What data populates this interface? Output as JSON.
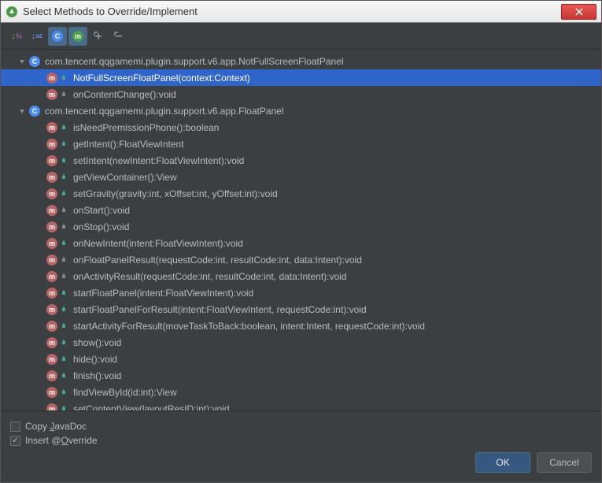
{
  "window": {
    "title": "Select Methods to Override/Implement"
  },
  "toolbar": {
    "sort_visibility": "↓%",
    "sort_alpha": "↓az",
    "filter_class": "C",
    "filter_method": "m",
    "expand": "⇱",
    "collapse": "⇲"
  },
  "tree": {
    "classes": [
      {
        "name": "com.tencent.qqgamemi.plugin.support.v6.app.NotFullScreenFloatPanel",
        "methods": [
          {
            "signature": "NotFullScreenFloatPanel(context:Context)",
            "visibility": "public",
            "selected": true
          },
          {
            "signature": "onContentChange():void",
            "visibility": "package"
          }
        ]
      },
      {
        "name": "com.tencent.qqgamemi.plugin.support.v6.app.FloatPanel",
        "methods": [
          {
            "signature": "isNeedPremissionPhone():boolean",
            "visibility": "public"
          },
          {
            "signature": "getIntent():FloatViewIntent",
            "visibility": "public"
          },
          {
            "signature": "setIntent(newIntent:FloatViewIntent):void",
            "visibility": "public"
          },
          {
            "signature": "getViewContainer():View",
            "visibility": "public"
          },
          {
            "signature": "setGravity(gravity:int, xOffset:int, yOffset:int):void",
            "visibility": "public"
          },
          {
            "signature": "onStart():void",
            "visibility": "package"
          },
          {
            "signature": "onStop():void",
            "visibility": "package"
          },
          {
            "signature": "onNewIntent(intent:FloatViewIntent):void",
            "visibility": "public"
          },
          {
            "signature": "onFloatPanelResult(requestCode:int, resultCode:int, data:Intent):void",
            "visibility": "package"
          },
          {
            "signature": "onActivityResult(requestCode:int, resultCode:int, data:Intent):void",
            "visibility": "package"
          },
          {
            "signature": "startFloatPanel(intent:FloatViewIntent):void",
            "visibility": "public"
          },
          {
            "signature": "startFloatPanelForResult(intent:FloatViewIntent, requestCode:int):void",
            "visibility": "public"
          },
          {
            "signature": "startActivityForResult(moveTaskToBack:boolean, intent:Intent, requestCode:int):void",
            "visibility": "public"
          },
          {
            "signature": "show():void",
            "visibility": "public"
          },
          {
            "signature": "hide():void",
            "visibility": "public"
          },
          {
            "signature": "finish():void",
            "visibility": "public"
          },
          {
            "signature": "findViewById(id:int):View",
            "visibility": "public"
          },
          {
            "signature": "setContentView(layoutResID:int):void",
            "visibility": "public"
          }
        ]
      }
    ]
  },
  "footer": {
    "copy_javadoc": "Copy JavaDoc",
    "insert_override": "Insert @Override",
    "ok": "OK",
    "cancel": "Cancel"
  }
}
